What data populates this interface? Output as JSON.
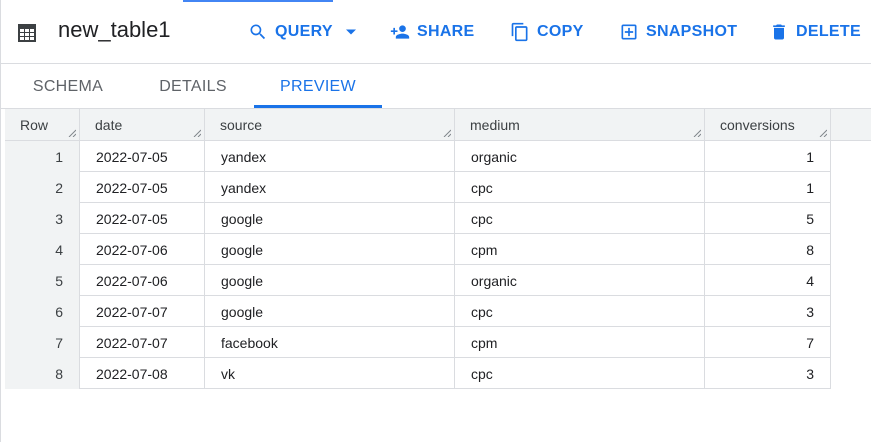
{
  "header": {
    "title": "new_table1",
    "buttons": {
      "query": "QUERY",
      "share": "SHARE",
      "copy": "COPY",
      "snapshot": "SNAPSHOT",
      "delete": "DELETE"
    }
  },
  "tabs": [
    {
      "label": "SCHEMA",
      "active": false
    },
    {
      "label": "DETAILS",
      "active": false
    },
    {
      "label": "PREVIEW",
      "active": true
    }
  ],
  "table": {
    "columns": [
      "Row",
      "date",
      "source",
      "medium",
      "conversions"
    ],
    "rows": [
      {
        "row": "1",
        "date": "2022-07-05",
        "source": "yandex",
        "medium": "organic",
        "conversions": "1"
      },
      {
        "row": "2",
        "date": "2022-07-05",
        "source": "yandex",
        "medium": "cpc",
        "conversions": "1"
      },
      {
        "row": "3",
        "date": "2022-07-05",
        "source": "google",
        "medium": "cpc",
        "conversions": "5"
      },
      {
        "row": "4",
        "date": "2022-07-06",
        "source": "google",
        "medium": "cpm",
        "conversions": "8"
      },
      {
        "row": "5",
        "date": "2022-07-06",
        "source": "google",
        "medium": "organic",
        "conversions": "4"
      },
      {
        "row": "6",
        "date": "2022-07-07",
        "source": "google",
        "medium": "cpc",
        "conversions": "3"
      },
      {
        "row": "7",
        "date": "2022-07-07",
        "source": "facebook",
        "medium": "cpm",
        "conversions": "7"
      },
      {
        "row": "8",
        "date": "2022-07-08",
        "source": "vk",
        "medium": "cpc",
        "conversions": "3"
      }
    ]
  },
  "colors": {
    "accent": "#1a73e8",
    "header_bg": "#f1f3f4",
    "border": "#dadce0"
  }
}
